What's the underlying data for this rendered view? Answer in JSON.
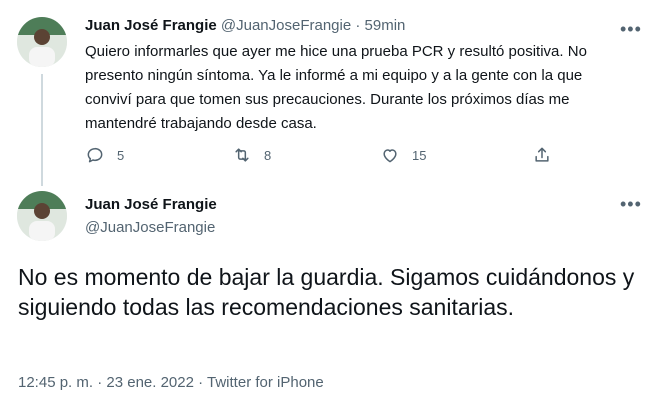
{
  "tweet1": {
    "author_name": "Juan José Frangie",
    "handle": "@JuanJoseFrangie",
    "separator": "·",
    "time": "59min",
    "text": "Quiero informarles que ayer me hice una prueba PCR y resultó positiva. No presento ningún síntoma. Ya le informé a mi equipo y a la gente con la que conviví para que tomen sus precauciones. Durante los próximos días me mantendré trabajando desde casa.",
    "more_icon": "more-horizontal-icon",
    "actions": {
      "reply": {
        "icon": "reply-icon",
        "count": "5"
      },
      "retweet": {
        "icon": "retweet-icon",
        "count": "8"
      },
      "like": {
        "icon": "like-icon",
        "count": "15"
      },
      "share": {
        "icon": "share-icon"
      }
    }
  },
  "tweet2": {
    "author_name": "Juan José Frangie",
    "handle": "@JuanJoseFrangie",
    "text": "No es momento de bajar la guardia. Sigamos cuidándonos y siguiendo todas las recomendaciones sanitarias.",
    "timestamp": "12:45 p. m. · 23 ene. 2022 · Twitter for iPhone",
    "more_icon": "more-horizontal-icon"
  },
  "colors": {
    "text_primary": "#0f1419",
    "text_secondary": "#536471",
    "thread_line": "#cfd9de",
    "background": "#ffffff"
  }
}
